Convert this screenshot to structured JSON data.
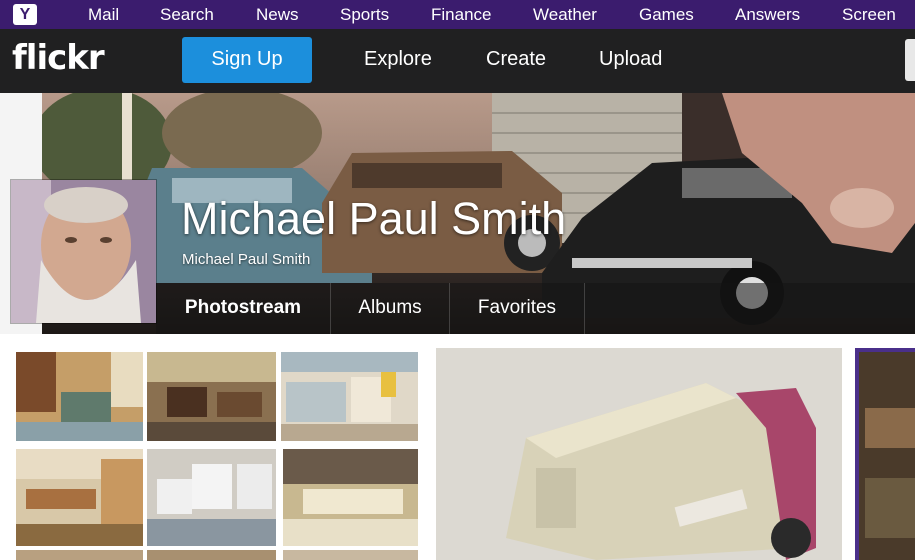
{
  "yahoo_bar": {
    "logo": "Y",
    "links": [
      "Mail",
      "Search",
      "News",
      "Sports",
      "Finance",
      "Weather",
      "Games",
      "Answers",
      "Screen"
    ]
  },
  "flickr_header": {
    "logo": "flickr",
    "signup": "Sign Up",
    "nav": [
      "Explore",
      "Create",
      "Upload"
    ]
  },
  "profile": {
    "name": "Michael Paul Smith",
    "subtitle": "Michael Paul Smith",
    "tabs": [
      "Photostream",
      "Albums",
      "Favorites"
    ],
    "active_tab": "Photostream"
  },
  "colors": {
    "yahoo_purple": "#3b1c6e",
    "flickr_header": "#202021",
    "signup_blue": "#1c8fdc"
  }
}
